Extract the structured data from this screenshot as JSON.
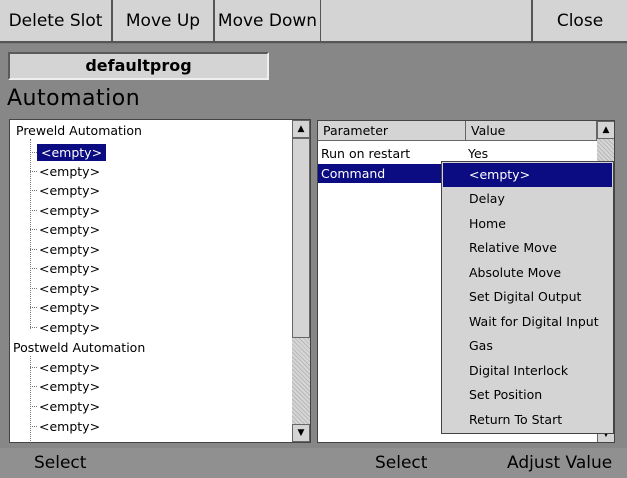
{
  "toolbar": {
    "delete_slot": "Delete Slot",
    "move_up": "Move Up",
    "move_down": "Move Down",
    "close": "Close"
  },
  "program_name": "defaultprog",
  "page_title": "Automation",
  "tree": {
    "preweld_label": "Preweld Automation",
    "preweld_items": [
      "<empty>",
      "<empty>",
      "<empty>",
      "<empty>",
      "<empty>",
      "<empty>",
      "<empty>",
      "<empty>",
      "<empty>",
      "<empty>"
    ],
    "postweld_label": "Postweld Automation",
    "postweld_items": [
      "<empty>",
      "<empty>",
      "<empty>",
      "<empty>"
    ]
  },
  "params": {
    "col_parameter": "Parameter",
    "col_value": "Value",
    "rows": [
      {
        "parameter": "Run on restart",
        "value": "Yes"
      },
      {
        "parameter": "Command",
        "value": ""
      }
    ]
  },
  "dropdown": {
    "options": [
      "<empty>",
      "Delay",
      "Home",
      "Relative Move",
      "Absolute Move",
      "Set Digital Output",
      "Wait for Digital Input",
      "Gas",
      "Digital Interlock",
      "Set Position",
      "Return To Start"
    ],
    "selected_index": 0
  },
  "bottom": {
    "left": "Select",
    "middle": "Select",
    "right": "Adjust Value"
  },
  "colors": {
    "selection": "#0b0b82",
    "panel": "#d4d4d4",
    "background": "#878787"
  }
}
